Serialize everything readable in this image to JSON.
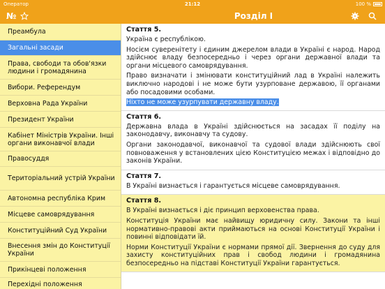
{
  "status_bar": {
    "carrier": "Оператор",
    "time": "21:12",
    "battery": "100 %"
  },
  "nav": {
    "title": "Розділ I",
    "number_label": "№",
    "star_icon": "star-outline-icon",
    "gear_icon": "gear-icon",
    "search_icon": "search-icon"
  },
  "colors": {
    "accent": "#f0a21a",
    "sidebar_bg": "#fbf3a4",
    "selection": "#4a8ee8"
  },
  "sidebar": {
    "items": [
      {
        "label": "Преамбула"
      },
      {
        "label": "Загальні засади"
      },
      {
        "label": "Права, свободи та обов'язки людини і громадянина"
      },
      {
        "label": "Вибори. Референдум"
      },
      {
        "label": "Верховна Рада України"
      },
      {
        "label": "Президент України"
      },
      {
        "label": "Кабінет Міністрів України. Інші органи виконавчої влади"
      },
      {
        "label": "Правосуддя"
      },
      {
        "label": "Територіальний устрій України"
      },
      {
        "label": "Автономна республіка Крим"
      },
      {
        "label": "Місцеве самоврядування"
      },
      {
        "label": "Конституційний Суд України"
      },
      {
        "label": "Внесення змін до Конституції України"
      },
      {
        "label": "Прикінцеві положення"
      },
      {
        "label": "Перехідні положення"
      }
    ]
  },
  "articles": [
    {
      "title": "Стаття 5.",
      "paragraphs": [
        "Україна є республікою.",
        "Носієм суверенітету і єдиним джерелом влади в Україні є народ. Народ здійснює владу безпосередньо і через органи державної влади та органи місцевого самоврядування.",
        "Право визначати і змінювати конституційний лад в Україні належить виключно народові і не може бути узурповане державою, її органами або посадовими особами."
      ],
      "highlight": "Ніхто не може узурпувати державну владу."
    },
    {
      "title": "Стаття 6.",
      "paragraphs": [
        "Державна влада в Україні здійснюється на засадах її поділу на законодавчу, виконавчу та судову.",
        "Органи законодавчої, виконавчої та судової влади здійснюють свої повноваження у встановлених цією Конституцією межах і відповідно до законів України."
      ]
    },
    {
      "title": "Стаття 7.",
      "paragraphs": [
        "В Україні визнається і гарантується місцеве самоврядування."
      ]
    },
    {
      "title": "Стаття 8.",
      "paragraphs": [
        "В Україні визнається і діє принцип верховенства права.",
        "Конституція України має найвищу юридичну силу. Закони та інші нормативно-правові акти приймаються на основі Конституції України і повинні відповідати їй.",
        "Норми Конституції України є нормами прямої дії. Звернення до суду для захисту конституційних прав і свобод людини і громадянина безпосередньо на підставі Конституції України гарантується."
      ]
    }
  ]
}
